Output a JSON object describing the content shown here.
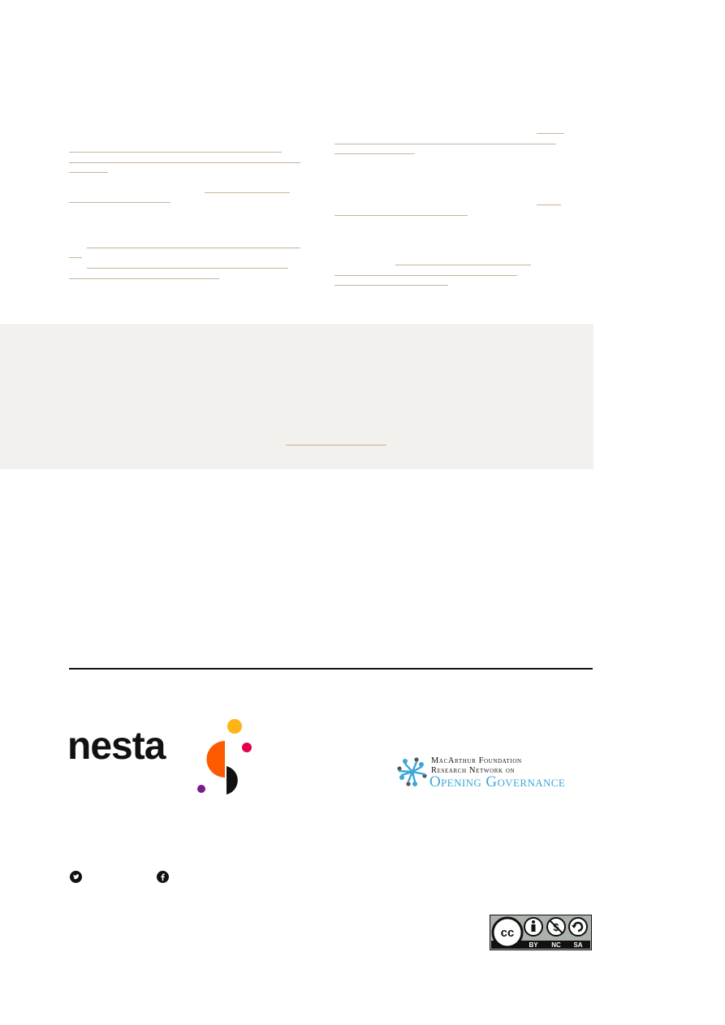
{
  "logos": {
    "nesta": "nesta",
    "macarthur_line1": "MacArthur Foundation",
    "macarthur_line2": "Research Network on",
    "macarthur_line3": "Opening Governance"
  },
  "license": {
    "by": "BY",
    "nc": "NC",
    "sa": "SA",
    "cc": "cc"
  },
  "icons": {
    "twitter": "twitter-icon",
    "facebook": "facebook-icon"
  },
  "colors": {
    "link_underline": "#c9b29a",
    "panel_background": "#f3f1ee",
    "nesta_orange": "#ff5a00",
    "nesta_yellow": "#fdb515",
    "nesta_pink": "#e6004c",
    "nesta_purple": "#7a1a8c",
    "macarthur_blue": "#3aa7d8"
  }
}
